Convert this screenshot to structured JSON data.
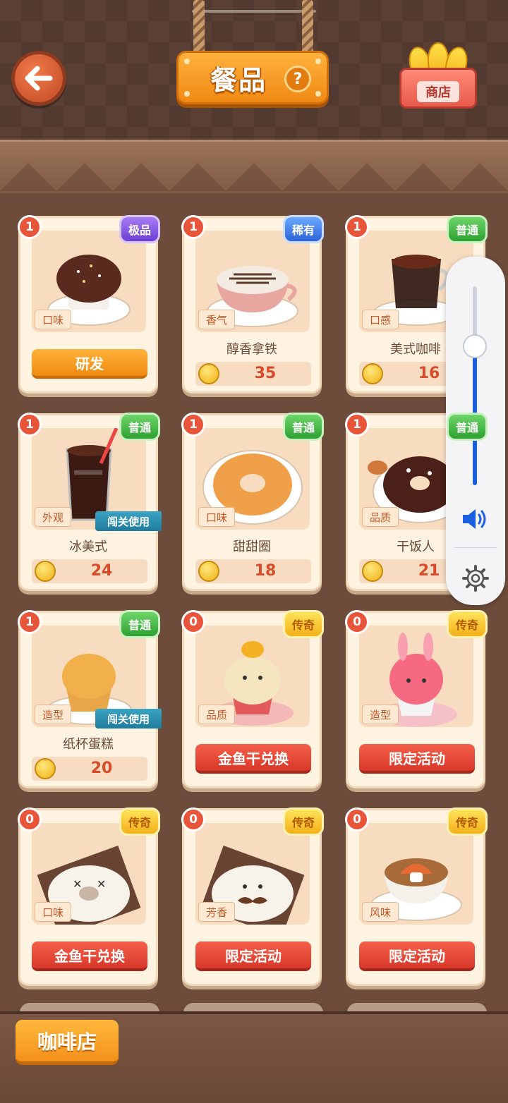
{
  "header": {
    "title": "餐品",
    "help_symbol": "?",
    "shop_label": "商店"
  },
  "cards": [
    {
      "count": "1",
      "rarity": "极品",
      "rarity_class": "r-epic",
      "trait": "口味",
      "name": "",
      "price": "",
      "action": "研发",
      "action_style": "btn-orange",
      "ribbon": "",
      "food": "chocolate-muffin"
    },
    {
      "count": "1",
      "rarity": "稀有",
      "rarity_class": "r-rare",
      "trait": "香气",
      "name": "醇香拿铁",
      "price": "35",
      "action": "",
      "action_style": "",
      "ribbon": "",
      "food": "latte"
    },
    {
      "count": "1",
      "rarity": "普通",
      "rarity_class": "r-common",
      "trait": "口感",
      "name": "美式咖啡",
      "price": "16",
      "action": "",
      "action_style": "",
      "ribbon": "",
      "food": "americano"
    },
    {
      "count": "1",
      "rarity": "普通",
      "rarity_class": "r-common",
      "trait": "外观",
      "name": "冰美式",
      "price": "24",
      "action": "",
      "action_style": "",
      "ribbon": "闯关使用",
      "food": "iced-americano"
    },
    {
      "count": "1",
      "rarity": "普通",
      "rarity_class": "r-common",
      "trait": "口味",
      "name": "甜甜圈",
      "price": "18",
      "action": "",
      "action_style": "",
      "ribbon": "",
      "food": "donut"
    },
    {
      "count": "1",
      "rarity": "普通",
      "rarity_class": "r-common",
      "trait": "品质",
      "name": "干饭人",
      "price": "21",
      "action": "",
      "action_style": "",
      "ribbon": "",
      "food": "choco-donut"
    },
    {
      "count": "1",
      "rarity": "普通",
      "rarity_class": "r-common",
      "trait": "造型",
      "name": "纸杯蛋糕",
      "price": "20",
      "action": "",
      "action_style": "",
      "ribbon": "闯关使用",
      "food": "cupcake"
    },
    {
      "count": "0",
      "rarity": "传奇",
      "rarity_class": "r-legend",
      "trait": "品质",
      "name": "",
      "price": "",
      "action": "金鱼干兑换",
      "action_style": "btn-red",
      "ribbon": "",
      "food": "face-cupcake"
    },
    {
      "count": "0",
      "rarity": "传奇",
      "rarity_class": "r-legend",
      "trait": "造型",
      "name": "",
      "price": "",
      "action": "限定活动",
      "action_style": "btn-red",
      "ribbon": "",
      "food": "pink-bunny-cake"
    },
    {
      "count": "0",
      "rarity": "传奇",
      "rarity_class": "r-legend",
      "trait": "口味",
      "name": "",
      "price": "",
      "action": "金鱼干兑换",
      "action_style": "btn-red",
      "ribbon": "",
      "food": "dizzy-donut"
    },
    {
      "count": "0",
      "rarity": "传奇",
      "rarity_class": "r-legend",
      "trait": "芳香",
      "name": "",
      "price": "",
      "action": "限定活动",
      "action_style": "btn-red",
      "ribbon": "",
      "food": "mustache-donut"
    },
    {
      "count": "0",
      "rarity": "传奇",
      "rarity_class": "r-legend",
      "trait": "风味",
      "name": "",
      "price": "",
      "action": "限定活动",
      "action_style": "btn-red",
      "ribbon": "",
      "food": "mushroom-latte"
    }
  ],
  "bottom_tab": {
    "label": "咖啡店"
  },
  "volume": {
    "level": 0.7,
    "accent": "#1a5fe0"
  },
  "colors": {
    "title_orange": "#f08a14",
    "badge_red": "#e8553a",
    "price_red": "#d84a2a"
  }
}
